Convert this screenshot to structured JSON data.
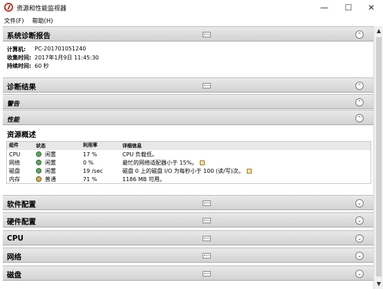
{
  "window": {
    "title": "资源和性能监视器",
    "controls": {
      "minimize": "—",
      "maximize": "☐",
      "close": "✕"
    }
  },
  "menu": [
    "文件(F)",
    "帮助(H)"
  ],
  "sections": {
    "diagnostic_report": {
      "title": "系统诊断报告",
      "info": [
        {
          "label": "计算机:",
          "value": "PC-201701051240"
        },
        {
          "label": "收集时间:",
          "value": "2017年1月9日 11:45:30"
        },
        {
          "label": "持续时间:",
          "value": "60 秒"
        }
      ]
    },
    "diagnostic_results": {
      "title": "诊断结果"
    },
    "warnings": {
      "title": "警告"
    },
    "performance": {
      "title": "性能"
    },
    "resource_overview": {
      "title": "资源概述",
      "columns": [
        "组件",
        "状态",
        "利用率",
        "详细信息"
      ],
      "rows": [
        {
          "component": "CPU",
          "status": "闲置",
          "status_color": "green",
          "usage": "17 %",
          "detail": "CPU 负载低。",
          "note": false
        },
        {
          "component": "网络",
          "status": "闲置",
          "status_color": "green",
          "usage": "0 %",
          "detail": "最忙的网络适配器小于 15%。",
          "note": true
        },
        {
          "component": "磁盘",
          "status": "闲置",
          "status_color": "green",
          "usage": "19 /sec",
          "detail": "磁盘 0 上的磁盘 I/O 为每秒小于 100 (读/写)次。",
          "note": true
        },
        {
          "component": "内存",
          "status": "普通",
          "status_color": "yellow",
          "usage": "71 %",
          "detail": "1186 MB 可用。",
          "note": false
        }
      ]
    },
    "software_config": {
      "title": "软件配置"
    },
    "hardware_config": {
      "title": "硬件配置"
    },
    "cpu": {
      "title": "CPU"
    },
    "network": {
      "title": "网络"
    },
    "disk": {
      "title": "磁盘"
    }
  },
  "icons": {
    "expand": "⌄",
    "collapse": "⌃",
    "scroll_up": "▲",
    "scroll_down": "▼"
  }
}
